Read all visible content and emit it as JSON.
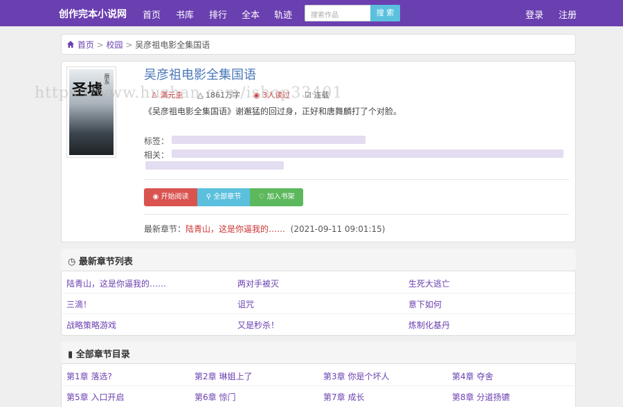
{
  "navbar": {
    "brand": "创作完本小说网",
    "links": [
      "首页",
      "书库",
      "排行",
      "全本",
      "轨迹"
    ],
    "search_placeholder": "搜索作品",
    "search_button": "搜 索",
    "login": "登录",
    "register": "注册"
  },
  "breadcrumb": {
    "home": "首页",
    "category": "校园",
    "current": "吴彦祖电影全集国语"
  },
  "book": {
    "cover_title": "圣墟",
    "cover_tag": "辰东",
    "title": "吴彦祖电影全集国语",
    "author": "满元圭",
    "words": "1861万字",
    "readers": "3人读过",
    "status": "连载",
    "intro": "《吴彦祖电影全集国语》谢邂猛的回过身，正好和唐舞麟打了个对脸。",
    "tags_label": "标签：",
    "related_label": "相关："
  },
  "buttons": {
    "read": "开始阅读",
    "all_chapters": "全部章节",
    "add_shelf": "加入书架"
  },
  "latest": {
    "label": "最新章节：",
    "chapter": "陆青山，这是你逼我的……",
    "time": "(2021-09-11 09:01:15)"
  },
  "latest_list": {
    "heading": "最新章节列表",
    "items": [
      "陆青山，这是你逼我的……",
      "两对手被灭",
      "生死大逃亡",
      "三滴！",
      "诅咒",
      "意下如何",
      "战略策略游戏",
      "又是秒杀！",
      "炼制化基丹"
    ]
  },
  "catalog": {
    "heading": "全部章节目录",
    "items": [
      "第1章 落选?",
      "第2章 琳姐上了",
      "第3章 你是个坏人",
      "第4章 夺舍",
      "第5章 入口开启",
      "第6章 惊门",
      "第7章 成长",
      "第8章 分道扬镳"
    ]
  },
  "watermark": "https://www.huzhan.com/ishop33401",
  "colors": {
    "navbar": "#6a3fb0",
    "link": "#6a3fb0",
    "title": "#4a78b8",
    "read": "#d9534f",
    "info": "#5bc0de",
    "success": "#5cb85c"
  }
}
